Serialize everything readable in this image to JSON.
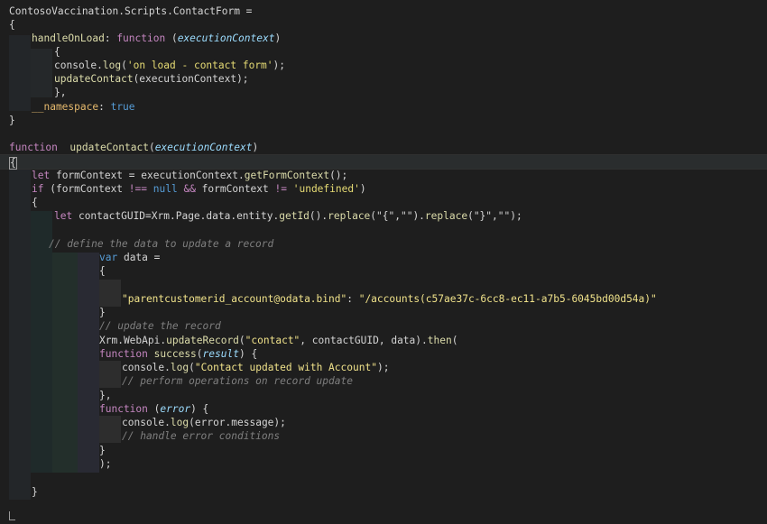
{
  "code": {
    "lines": [
      [
        "ContosoVaccination.Scripts.ContactForm ="
      ],
      [
        "{"
      ],
      [
        "handleOnLoad",
        ": ",
        "function",
        " (",
        "executionContext",
        ")"
      ],
      [
        "{"
      ],
      [
        "console",
        ".",
        "log",
        "(",
        "'on load - contact form'",
        ");"
      ],
      [
        "updateContact",
        "(executionContext);"
      ],
      [
        "},"
      ],
      [
        "__namespace",
        ": ",
        "true"
      ],
      [
        "}"
      ],
      [
        ""
      ],
      [
        "function",
        "  ",
        "updateContact",
        "(",
        "executionContext",
        ")"
      ],
      [
        "{"
      ],
      [
        "let",
        " formContext = executionContext.",
        "getFormContext",
        "();"
      ],
      [
        "if",
        " (formContext ",
        "!==",
        " ",
        "null",
        " ",
        "&&",
        " formContext ",
        "!=",
        " ",
        "'undefined'",
        ")"
      ],
      [
        "{"
      ],
      [
        "let",
        " contactGUID=Xrm.Page.data.entity.",
        "getId",
        "().",
        "replace",
        "(\"{\",\"\").",
        "replace",
        "(\"}\",\"\");"
      ],
      [
        ""
      ],
      [
        "// define the data to update a record"
      ],
      [
        "var",
        " data ="
      ],
      [
        "{"
      ],
      [
        ""
      ],
      [
        "\"parentcustomerid_account@odata.bind\"",
        ": ",
        "\"/accounts(c57ae37c-6cc8-ec11-a7b5-6045bd00d54a)\""
      ],
      [
        "}"
      ],
      [
        "// update the record"
      ],
      [
        "Xrm.WebApi.",
        "updateRecord",
        "(",
        "\"contact\"",
        ", contactGUID, data).",
        "then",
        "("
      ],
      [
        "function",
        " ",
        "success",
        "(",
        "result",
        ") {"
      ],
      [
        "console",
        ".",
        "log",
        "(",
        "\"Contact updated with Account\"",
        ");"
      ],
      [
        "// perform operations on record update"
      ],
      [
        "},"
      ],
      [
        "function",
        " (",
        "error",
        ") {"
      ],
      [
        "console",
        ".",
        "log",
        "(error.message);"
      ],
      [
        "// handle error conditions"
      ],
      [
        "}"
      ],
      [
        ");"
      ],
      [
        ""
      ],
      [
        "}"
      ]
    ]
  },
  "colors": {
    "background": "#1e1e1e",
    "keyword": "#569cd6",
    "function_name": "#dcdcaa",
    "string": "#e6db74",
    "comment": "#6a9955"
  }
}
